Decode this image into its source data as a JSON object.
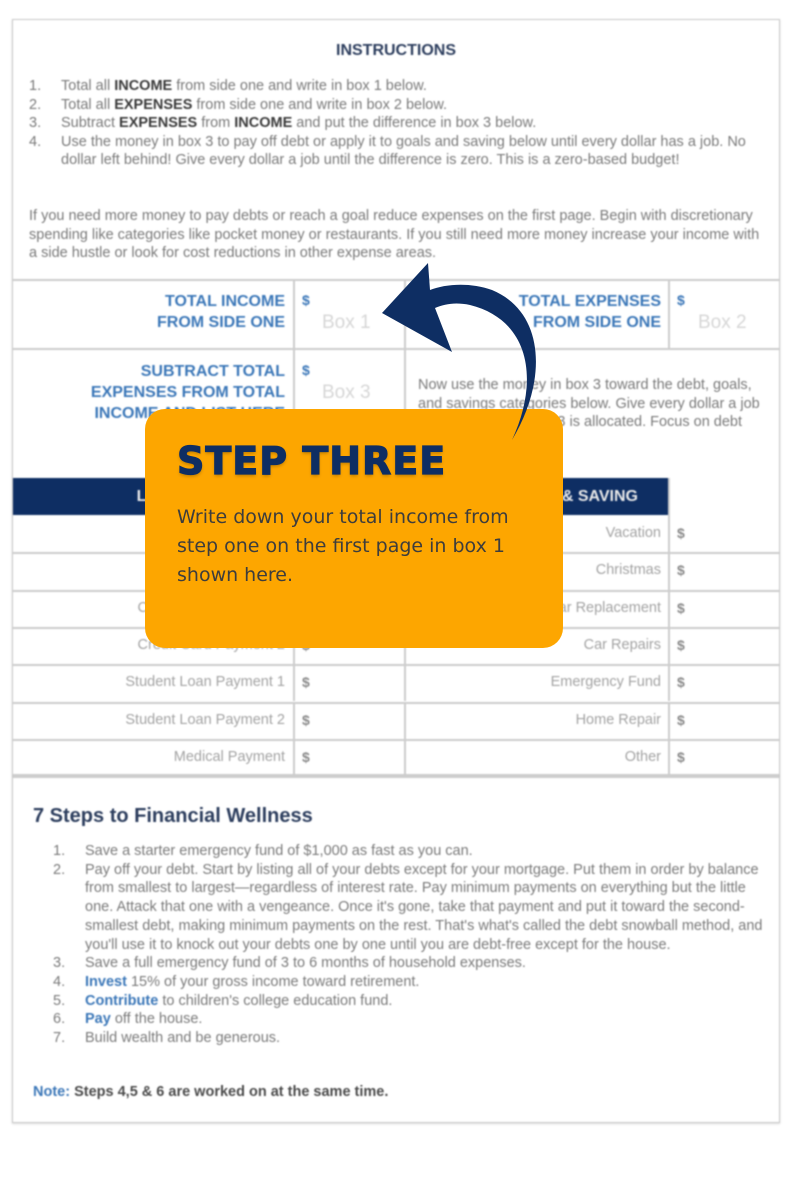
{
  "instructions": {
    "title": "INSTRUCTIONS",
    "items": [
      {
        "num": "1.",
        "pre": "Total all ",
        "bold": "INCOME",
        "post": " from side one and write in box 1 below."
      },
      {
        "num": "2.",
        "pre": "Total all ",
        "bold": "EXPENSES",
        "post": " from side one and write in box 2 below."
      },
      {
        "num": "3.",
        "pre": "Subtract ",
        "bold": "EXPENSES",
        "mid": " from ",
        "bold2": "INCOME",
        "post": " and put the difference in box 3 below."
      },
      {
        "num": "4.",
        "text": "Use the money in box 3 to pay off debt or apply it to goals and saving below until every dollar has a job.  No dollar left behind!  Give every dollar a job until the difference is zero.  This is a zero-based budget!"
      }
    ],
    "paragraph": "If you need more money to pay debts or reach a goal reduce expenses on the first page. Begin with discretionary spending like categories like pocket money or restaurants.  If you still need more money increase your income with a side hustle or look for cost reductions in other expense areas."
  },
  "totals": {
    "income_label_1": "TOTAL INCOME",
    "income_label_2": "FROM SIDE ONE",
    "box1": "Box 1",
    "expenses_label_1": "TOTAL EXPENSES",
    "expenses_label_2": "FROM SIDE ONE",
    "box2": "Box 2",
    "subtract_label_1": "SUBTRACT TOTAL",
    "subtract_label_2": "EXPENSES FROM  TOTAL",
    "subtract_label_3": "INCOME AND LIST HERE",
    "box3": "Box 3",
    "dollar": "$",
    "box3_note": "Now use the money in box 3 toward the debt, goals, and savings categories below. Give every dollar a job until all money in box 3 is allocated. Focus on debt first."
  },
  "table": {
    "left_header": "LIST YOUR DEBTS",
    "right_header": "GOALS & SAVING",
    "left_rows": [
      "",
      "",
      "Credit Card Payment 1",
      "Credit Card Payment 2",
      "Student Loan Payment 1",
      "Student Loan Payment 2",
      "Medical Payment"
    ],
    "right_rows": [
      "Vacation",
      "Christmas",
      "Car Replacement",
      "Car Repairs",
      "Emergency Fund",
      "Home Repair",
      "Other"
    ],
    "dollar": "$"
  },
  "steps": {
    "title": "7 Steps to Financial Wellness",
    "items": [
      {
        "num": "1.",
        "text": "Save a starter emergency fund of $1,000 as fast as you can."
      },
      {
        "num": "2.",
        "text": "Pay off your debt.  Start by listing all of your debts except for your mortgage. Put them in order by balance from smallest to largest—regardless of interest rate. Pay minimum payments on everything but the little one. Attack that one with a vengeance. Once it's gone, take that payment and put it toward the second-smallest debt, making minimum payments on the rest. That's what's called the debt snowball method, and you'll use it to knock out your debts one by one until you are debt-free except for the house."
      },
      {
        "num": "3.",
        "text": "Save a full emergency fund of 3 to 6 months of household expenses."
      },
      {
        "num": "4.",
        "kw": "Invest",
        "text": " 15% of your gross income toward retirement."
      },
      {
        "num": "5.",
        "kw": "Contribute",
        "text": " to children's college education fund."
      },
      {
        "num": "6.",
        "kw": "Pay",
        "text": " off the house."
      },
      {
        "num": "7.",
        "text": "Build wealth and be generous."
      }
    ],
    "note_label": "Note:",
    "note_text": " Steps 4,5 & 6 are worked on at the same time."
  },
  "callout": {
    "title": "STEP THREE",
    "body": "Write down your total income from step one on the first page in box 1 shown here.",
    "bg_color": "#fda600",
    "title_color": "#0e2e63"
  },
  "arrow": {
    "icon": "curved-arrow-icon",
    "color": "#0e2e63",
    "points_to": "Box 1"
  }
}
